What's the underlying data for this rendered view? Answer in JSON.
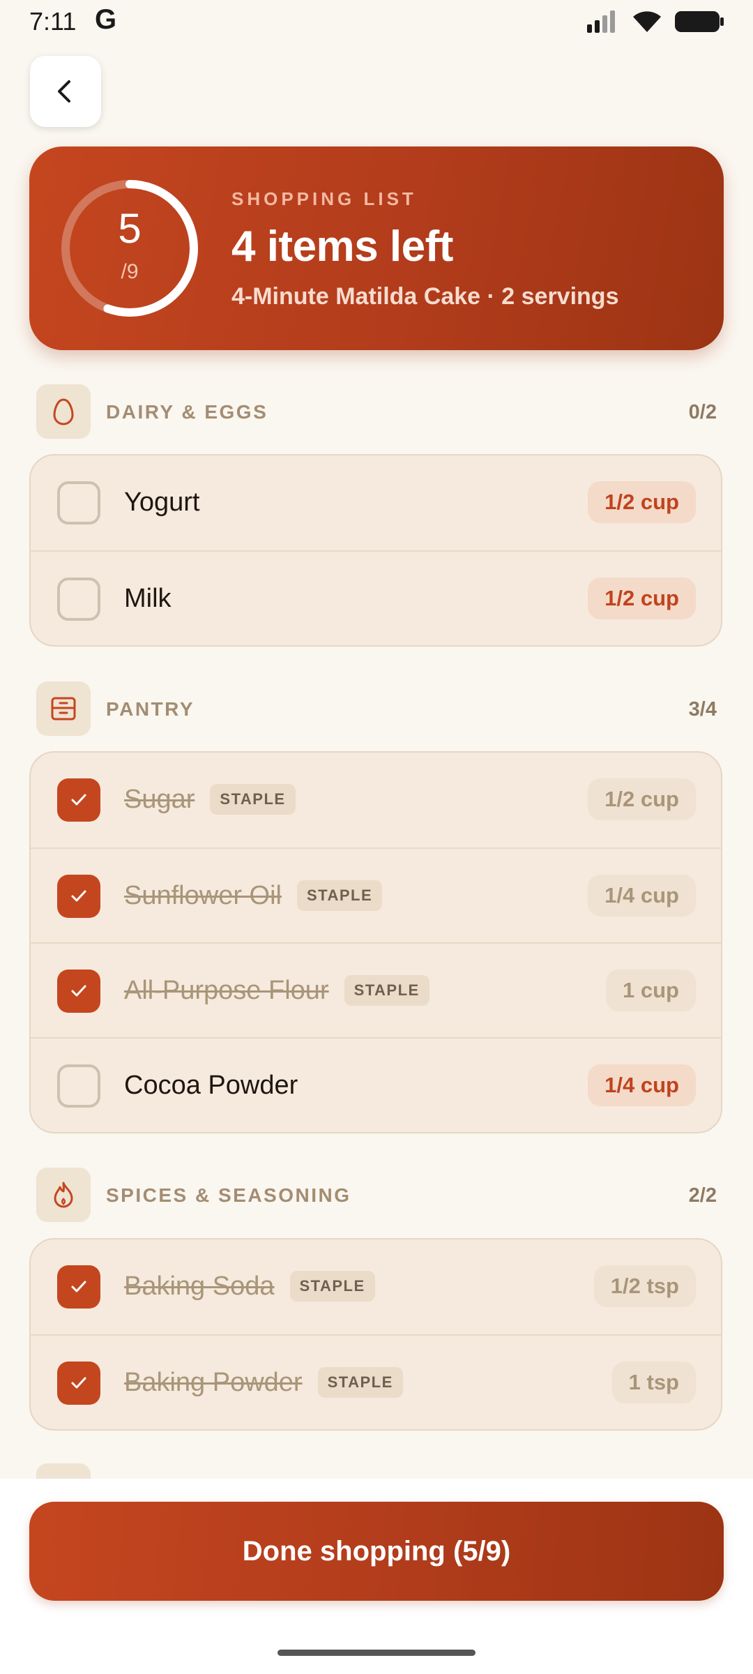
{
  "status_bar": {
    "time": "7:11",
    "app_glyph": "G"
  },
  "back_label": "Back",
  "summary": {
    "checked": 5,
    "total": 9,
    "checked_text": "5",
    "total_text": "/9",
    "kicker": "SHOPPING LIST",
    "title": "4 items left",
    "subtitle": "4-Minute Matilda Cake · 2 servings"
  },
  "sections": [
    {
      "title": "DAIRY & EGGS",
      "count": "0/2",
      "icon": "egg-icon",
      "items": [
        {
          "name": "Yogurt",
          "qty": "1/2 cup",
          "checked": false,
          "staple": ""
        },
        {
          "name": "Milk",
          "qty": "1/2 cup",
          "checked": false,
          "staple": ""
        }
      ]
    },
    {
      "title": "PANTRY",
      "count": "3/4",
      "icon": "pantry-box-icon",
      "items": [
        {
          "name": "Sugar",
          "qty": "1/2 cup",
          "checked": true,
          "staple": "STAPLE"
        },
        {
          "name": "Sunflower Oil",
          "qty": "1/4 cup",
          "checked": true,
          "staple": "STAPLE"
        },
        {
          "name": "All-Purpose Flour",
          "qty": "1 cup",
          "checked": true,
          "staple": "STAPLE"
        },
        {
          "name": "Cocoa Powder",
          "qty": "1/4 cup",
          "checked": false,
          "staple": ""
        }
      ]
    },
    {
      "title": "SPICES & SEASONING",
      "count": "2/2",
      "icon": "flame-icon",
      "items": [
        {
          "name": "Baking Soda",
          "qty": "1/2 tsp",
          "checked": true,
          "staple": "STAPLE"
        },
        {
          "name": "Baking Powder",
          "qty": "1 tsp",
          "checked": true,
          "staple": "STAPLE"
        }
      ]
    }
  ],
  "done_button": "Done shopping (5/9)",
  "colors": {
    "accent": "#c4461f",
    "accent_dark": "#9c3413",
    "card_bg": "#f5eadd",
    "page_bg": "#faf6f0"
  }
}
